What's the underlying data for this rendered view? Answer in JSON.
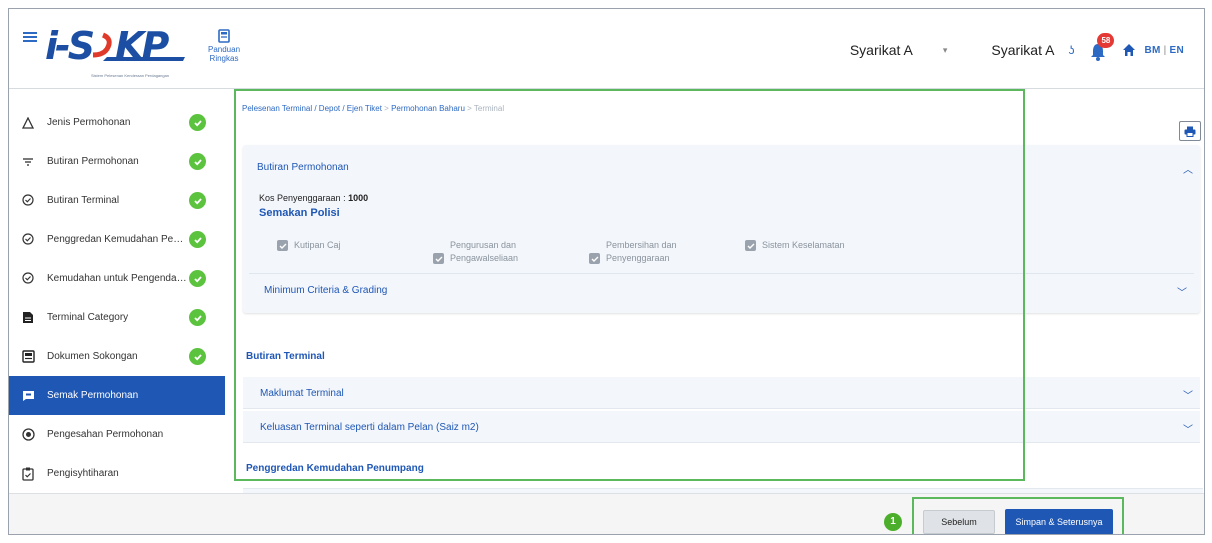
{
  "header": {
    "logo_main": "i-SPKP",
    "logo_sub": "Sistem Pelesenan Kenderaan Perdagangan",
    "panduan_label": "Panduan Ringkas",
    "company_selected": "Syarikat A",
    "company_name": "Syarikat A",
    "notification_count": "58",
    "lang_bm": "BM",
    "lang_sep": "|",
    "lang_en": "EN"
  },
  "sidebar": {
    "items": [
      {
        "label": "Jenis Permohonan",
        "icon": "triangle-icon",
        "done": true
      },
      {
        "label": "Butiran Permohonan",
        "icon": "filter-icon",
        "done": true
      },
      {
        "label": "Butiran Terminal",
        "icon": "check-plus-icon",
        "done": true
      },
      {
        "label": "Penggredan Kemudahan Pen...",
        "icon": "check-plus-icon",
        "done": true
      },
      {
        "label": "Kemudahan untuk Pengendali...",
        "icon": "check-plus-icon",
        "done": true
      },
      {
        "label": "Terminal Category",
        "icon": "document-icon",
        "done": true
      },
      {
        "label": "Dokumen Sokongan",
        "icon": "docs-icon",
        "done": true
      },
      {
        "label": "Semak Permohonan",
        "icon": "review-icon",
        "done": false,
        "active": true
      },
      {
        "label": "Pengesahan Permohonan",
        "icon": "circle-check-icon",
        "done": false
      },
      {
        "label": "Pengisyhtiharan",
        "icon": "clipboard-icon",
        "done": false
      }
    ]
  },
  "breadcrumb": {
    "path": "Pelesenan Terminal / Depot / Ejen Tiket",
    "sep1": " > ",
    "step": "Permohonan Baharu",
    "sep2": " > ",
    "current": "Terminal"
  },
  "panel": {
    "title": "Butiran Permohonan",
    "kos_label": "Kos Penyenggaraan : ",
    "kos_value": "1000",
    "semakan_title": "Semakan Polisi",
    "checkboxes": [
      {
        "line1": "Kutipan Caj",
        "line2": ""
      },
      {
        "line1": "Pengurusan dan",
        "line2": "Pengawalseliaan"
      },
      {
        "line1": "Pembersihan dan",
        "line2": "Penyenggaraan"
      },
      {
        "line1": "Sistem Keselamatan",
        "line2": ""
      }
    ],
    "sub_accordion": "Minimum Criteria & Grading"
  },
  "terminal_section": {
    "title": "Butiran Terminal",
    "accordions": [
      "Maklumat Terminal",
      "Keluasan Terminal seperti dalam Pelan (Saiz m2)"
    ]
  },
  "penggredan_section": {
    "title": "Penggredan Kemudahan Penumpang"
  },
  "footer": {
    "step_badge": "1",
    "prev_label": "Sebelum",
    "next_label": "Simpan & Seterusnya"
  },
  "colors": {
    "primary": "#1f57b5",
    "check_green": "#5cc33f",
    "highlight": "#5cb85c",
    "badge_red": "#e53935"
  }
}
